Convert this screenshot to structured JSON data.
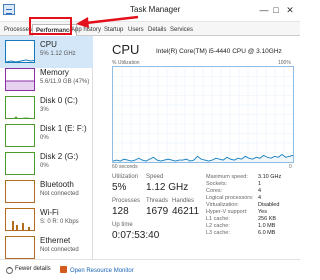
{
  "window": {
    "title": "Task Manager",
    "minimize_glyph": "—",
    "maximize_glyph": "□",
    "close_glyph": "✕"
  },
  "tabs": [
    {
      "label": "Processes",
      "active": false
    },
    {
      "label": "Performance",
      "active": true
    },
    {
      "label": "App history",
      "active": false
    },
    {
      "label": "Startup",
      "active": false
    },
    {
      "label": "Users",
      "active": false
    },
    {
      "label": "Details",
      "active": false
    },
    {
      "label": "Services",
      "active": false
    }
  ],
  "annotation": {
    "color": "#e3101b"
  },
  "sidebar": {
    "items": [
      {
        "name": "CPU",
        "sub": "5% 1.12 GHz",
        "color": "#1779ba",
        "active": true
      },
      {
        "name": "Memory",
        "sub": "5.6/11.9 GB (47%)",
        "color": "#8b2fa5",
        "active": false
      },
      {
        "name": "Disk 0 (C:)",
        "sub": "3%",
        "color": "#4c9a2a",
        "active": false
      },
      {
        "name": "Disk 1 (E: F:)",
        "sub": "0%",
        "color": "#4c9a2a",
        "active": false
      },
      {
        "name": "Disk 2 (G:)",
        "sub": "0%",
        "color": "#4c9a2a",
        "active": false
      },
      {
        "name": "Bluetooth",
        "sub": "Not connected",
        "color": "#b36b1e",
        "active": false
      },
      {
        "name": "Wi-Fi",
        "sub": "S: 0 R: 0 Kbps",
        "color": "#b36b1e",
        "active": false
      },
      {
        "name": "Ethernet",
        "sub": "Not connected",
        "color": "#b36b1e",
        "active": false
      }
    ]
  },
  "main": {
    "title": "CPU",
    "model": "Intel(R) Core(TM) i5-4440 CPU @ 3.10GHz",
    "util_label": "% Utilization",
    "pct_max": "100%",
    "time_label": "60 seconds",
    "time_min": "0",
    "graph_color": "#117dbb",
    "graph_fill": "#f1f6fb",
    "utilization": [
      1,
      2,
      1,
      3,
      2,
      1,
      2,
      4,
      2,
      1,
      3,
      5,
      2,
      1,
      2,
      3,
      2,
      1,
      2,
      2,
      3,
      1,
      2,
      6,
      3,
      2,
      1,
      2,
      4,
      3,
      2,
      5,
      3,
      2,
      4,
      3,
      6,
      4,
      3,
      5,
      4,
      7,
      5,
      4,
      6,
      5,
      8,
      5,
      6,
      7
    ]
  },
  "stats": {
    "utilization": {
      "label": "Utilization",
      "value": "5%"
    },
    "speed": {
      "label": "Speed",
      "value": "1.12 GHz"
    },
    "processes": {
      "label": "Processes",
      "value": "128"
    },
    "threads": {
      "label": "Threads",
      "value": "1679"
    },
    "handles": {
      "label": "Handles",
      "value": "46211"
    },
    "uptime": {
      "label": "Up time",
      "value": "0:07:53:40"
    }
  },
  "specs": [
    {
      "label": "Maximum speed:",
      "value": "3.10 GHz"
    },
    {
      "label": "Sockets:",
      "value": "1"
    },
    {
      "label": "Cores:",
      "value": "4"
    },
    {
      "label": "Logical processors:",
      "value": "4"
    },
    {
      "label": "Virtualization:",
      "value": "Disabled"
    },
    {
      "label": "Hyper-V support:",
      "value": "Yes"
    },
    {
      "label": "L1 cache:",
      "value": "256 KB"
    },
    {
      "label": "L2 cache:",
      "value": "1.0 MB"
    },
    {
      "label": "L3 cache:",
      "value": "6.0 MB"
    }
  ],
  "footer": {
    "fewer_details": "Fewer details",
    "open_resource_monitor": "Open Resource Monitor"
  }
}
